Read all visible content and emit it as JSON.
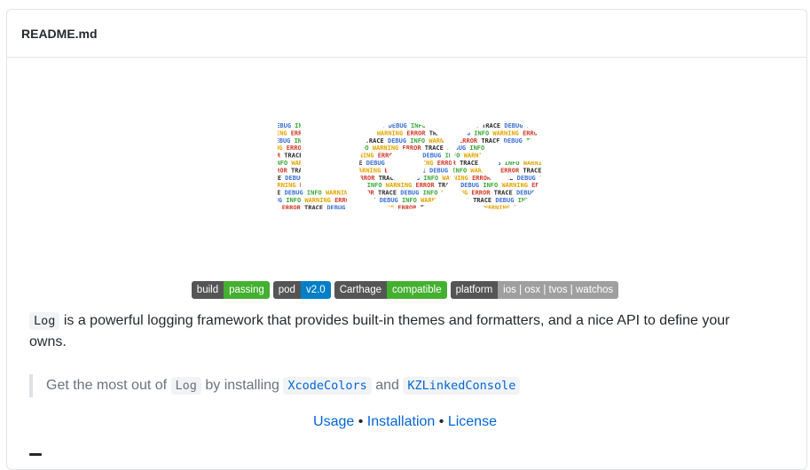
{
  "file_title": "README.md",
  "logo": {
    "alt": "Log",
    "letters": [
      "L",
      "o",
      "g"
    ],
    "words": [
      "DEBUG",
      "INFO",
      "WARNING",
      "ERROR",
      "TRACE"
    ],
    "colors": {
      "DEBUG": "#3b6fd4",
      "INFO": "#3aa83a",
      "WARNING": "#e3a400",
      "ERROR": "#d23a2a",
      "TRACE": "#2b2b2b"
    }
  },
  "badges": [
    {
      "label": "build",
      "value": "passing",
      "color": "#4c1"
    },
    {
      "label": "pod",
      "value": "v2.0",
      "color": "#007ec6"
    },
    {
      "label": "Carthage",
      "value": "compatible",
      "color": "#4c1"
    },
    {
      "label": "platform",
      "value": "ios | osx | tvos | watchos",
      "color": "#9f9f9f"
    }
  ],
  "intro": {
    "code": "Log",
    "text": " is a powerful logging framework that provides built-in themes and formatters, and a nice API to define your owns."
  },
  "quote": {
    "prefix": "Get the most out of ",
    "code": "Log",
    "middle": " by installing ",
    "link1": "XcodeColors",
    "and": " and ",
    "link2": "KZLinkedConsole"
  },
  "links": {
    "usage": "Usage",
    "installation": "Installation",
    "license": "License",
    "separator": "•"
  }
}
